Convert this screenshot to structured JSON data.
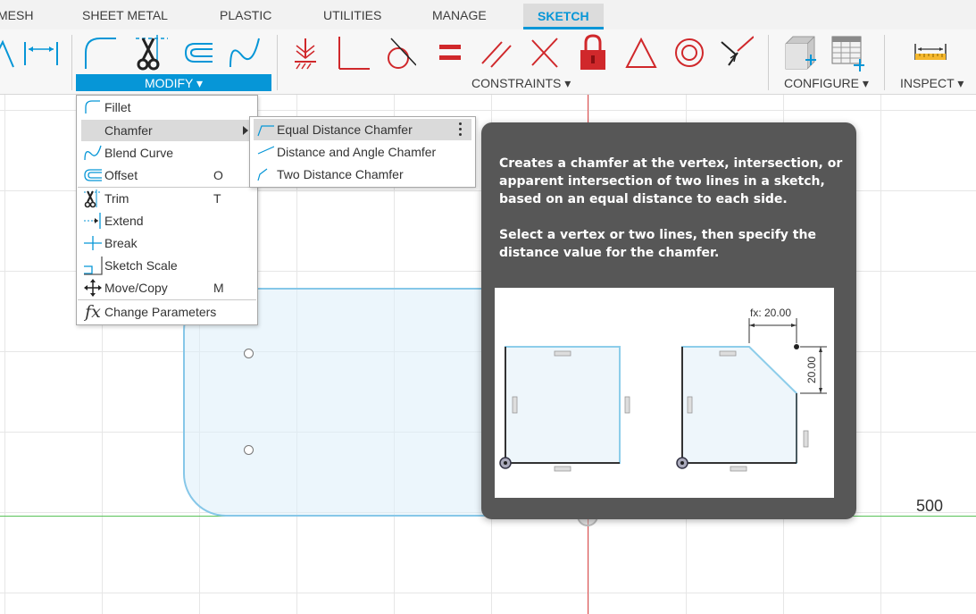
{
  "tabs": [
    {
      "label": "MESH",
      "active": false
    },
    {
      "label": "SHEET METAL",
      "active": false
    },
    {
      "label": "PLASTIC",
      "active": false
    },
    {
      "label": "UTILITIES",
      "active": false
    },
    {
      "label": "MANAGE",
      "active": false
    },
    {
      "label": "SKETCH",
      "active": true
    }
  ],
  "ribbon": {
    "modify_label": "MODIFY ▾",
    "constraints_label": "CONSTRAINTS ▾",
    "configure_label": "CONFIGURE ▾",
    "inspect_label": "INSPECT ▾"
  },
  "modify_menu": {
    "items": [
      {
        "label": "Fillet",
        "key": "",
        "icon": "fillet-icon"
      },
      {
        "label": "Chamfer",
        "key": "",
        "icon": "none",
        "submenu": true,
        "highlighted": true
      },
      {
        "label": "Blend Curve",
        "key": "",
        "icon": "blend-curve-icon"
      },
      {
        "label": "Offset",
        "key": "O",
        "icon": "offset-icon"
      },
      {
        "label": "Trim",
        "key": "T",
        "icon": "trim-icon"
      },
      {
        "label": "Extend",
        "key": "",
        "icon": "extend-icon"
      },
      {
        "label": "Break",
        "key": "",
        "icon": "break-icon"
      },
      {
        "label": "Sketch Scale",
        "key": "",
        "icon": "sketch-scale-icon"
      },
      {
        "label": "Move/Copy",
        "key": "M",
        "icon": "move-copy-icon"
      },
      {
        "label": "Change Parameters",
        "key": "",
        "icon": "fx-icon"
      }
    ]
  },
  "chamfer_submenu": {
    "items": [
      {
        "label": "Equal Distance Chamfer",
        "highlighted": true
      },
      {
        "label": "Distance and Angle Chamfer",
        "highlighted": false
      },
      {
        "label": "Two Distance Chamfer",
        "highlighted": false
      }
    ]
  },
  "tooltip": {
    "paragraph1": "Creates a chamfer at the vertex, intersection, or apparent intersection of two lines in a sketch, based on an equal distance to each side.",
    "paragraph2": "Select a vertex or two lines, then specify the distance value for the chamfer.",
    "image": {
      "dim_horizontal": "fx: 20.00",
      "dim_vertical": "20.00"
    }
  },
  "canvas": {
    "dimension_label": "500"
  },
  "colors": {
    "accent": "#0696d7",
    "sketch_line": "#86c7e8",
    "x_axis": "#e34b4b",
    "y_axis": "#59c259",
    "tooltip_bg": "#575757"
  }
}
